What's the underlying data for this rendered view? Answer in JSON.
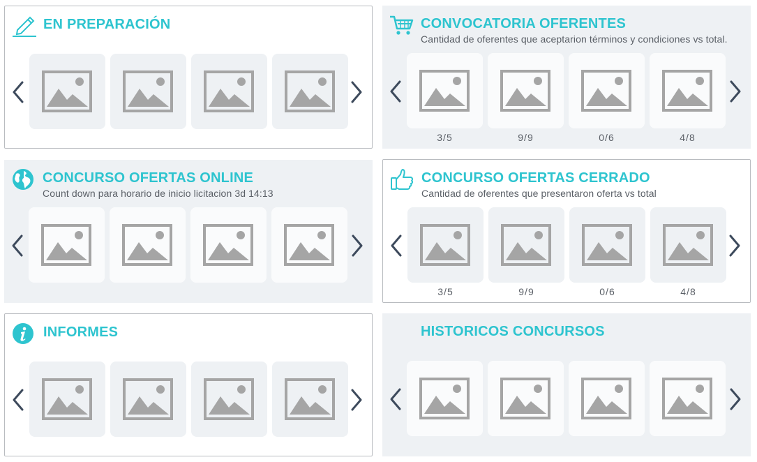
{
  "accent_color": "#2ec4cf",
  "sections": [
    {
      "title": "EN PREPARACIÓN",
      "subtitle": "",
      "icon": "pencil-icon",
      "tiles": 4,
      "counts": []
    },
    {
      "title": "CONVOCATORIA OFERENTES",
      "subtitle": "Cantidad de oferentes que aceptarion términos y condiciones vs total.",
      "icon": "shopping-cart-icon",
      "tiles": 4,
      "counts": [
        "3/5",
        "9/9",
        "0/6",
        "4/8"
      ]
    },
    {
      "title": "CONCURSO OFERTAS ONLINE",
      "subtitle": "Count down para horario de inicio licitacion 3d 14:13",
      "icon": "globe-icon",
      "tiles": 4,
      "counts": []
    },
    {
      "title": "CONCURSO OFERTAS CERRADO",
      "subtitle": "Cantidad de oferentes que presentaron oferta vs total",
      "icon": "thumbs-up-icon",
      "tiles": 4,
      "counts": [
        "3/5",
        "9/9",
        "0/6",
        "4/8"
      ]
    },
    {
      "title": "INFORMES",
      "subtitle": "",
      "icon": "info-icon",
      "tiles": 4,
      "counts": []
    },
    {
      "title": "HISTORICOS CONCURSOS",
      "subtitle": "",
      "icon": "",
      "tiles": 4,
      "counts": []
    }
  ]
}
